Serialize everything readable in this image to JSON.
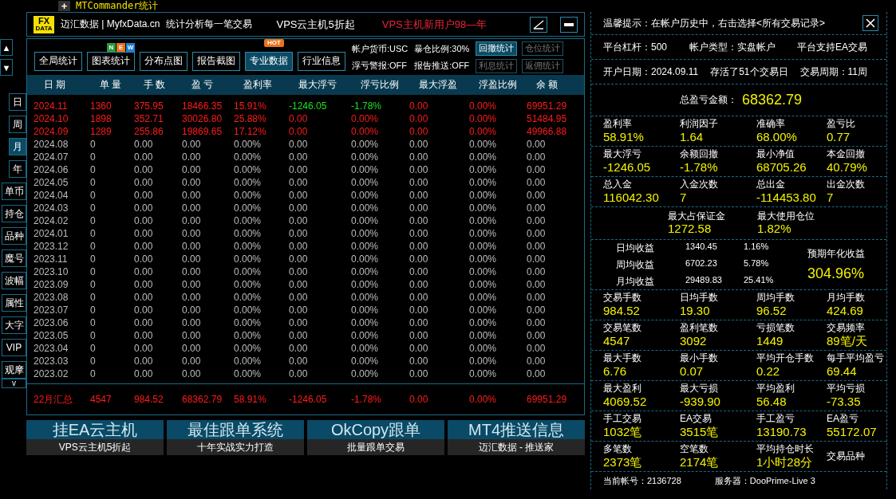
{
  "top_bar": {
    "expand_button": "+",
    "title": "MTCommander统计"
  },
  "header": {
    "logo_top": "FX",
    "logo_bottom": "DATA",
    "brand": "迈汇数据 | MyfxData.cn",
    "slogan": "统计分析每一笔交易",
    "promo": "VPS云主机5折起",
    "promo_highlight": "VPS主机新用户98—年"
  },
  "side_nav": {
    "up": "▲",
    "down": "▼",
    "items": [
      {
        "label": "日",
        "selected": false,
        "kind": "period"
      },
      {
        "label": "周",
        "selected": false,
        "kind": "period"
      },
      {
        "label": "月",
        "selected": true,
        "kind": "period"
      },
      {
        "label": "年",
        "selected": false,
        "kind": "period"
      },
      {
        "label": "单币",
        "selected": false,
        "kind": "view"
      },
      {
        "label": "持仓",
        "selected": false,
        "kind": "view"
      },
      {
        "label": "品种",
        "selected": false,
        "kind": "view"
      },
      {
        "label": "魔号",
        "selected": false,
        "kind": "view"
      },
      {
        "label": "波幅",
        "selected": false,
        "kind": "view"
      },
      {
        "label": "属性",
        "selected": false,
        "kind": "view"
      },
      {
        "label": "大字",
        "selected": false,
        "kind": "view"
      },
      {
        "label": "VIP",
        "selected": false,
        "kind": "view"
      },
      {
        "label": "观摩",
        "selected": false,
        "kind": "view"
      }
    ],
    "more": "v"
  },
  "tabs": [
    {
      "label": "全局统计",
      "selected": false
    },
    {
      "label": "图表统计",
      "selected": false,
      "badge_letters": [
        {
          "text": "N",
          "color": "#2a9a3a"
        },
        {
          "text": "E",
          "color": "#e8731a"
        },
        {
          "text": "W",
          "color": "#1f7fd6"
        }
      ]
    },
    {
      "label": "分布点图",
      "selected": false
    },
    {
      "label": "报告截图",
      "selected": false
    },
    {
      "label": "专业数据",
      "selected": true,
      "badge": "HOT"
    },
    {
      "label": "行业信息",
      "selected": false
    }
  ],
  "account_info": [
    "帐户货币:USC",
    "暴仓比例:30%",
    "浮亏警报:OFF",
    "报告推送:OFF"
  ],
  "tool_buttons": [
    {
      "label": "回撤统计",
      "disabled": false
    },
    {
      "label": "仓位统计",
      "disabled": true
    },
    {
      "label": "利息统计",
      "disabled": true
    },
    {
      "label": "返佣统计",
      "disabled": true
    }
  ],
  "table": {
    "columns": [
      "日 期",
      "单 量",
      "手 数",
      "盈 亏",
      "盈利率",
      "最大浮亏",
      "浮亏比例",
      "最大浮盈",
      "浮盈比例",
      "余 额"
    ],
    "rows": [
      {
        "active": true,
        "floating_loss": true,
        "cells": [
          "2024.11",
          "1360",
          "375.95",
          "18466.35",
          "15.91%",
          "-1246.05",
          "-1.78%",
          "0.00",
          "0.00%",
          "69951.29"
        ]
      },
      {
        "active": true,
        "floating_loss": false,
        "cells": [
          "2024.10",
          "1898",
          "352.71",
          "30026.80",
          "25.88%",
          "0.00",
          "0.00%",
          "0.00",
          "0.00%",
          "51484.95"
        ]
      },
      {
        "active": true,
        "floating_loss": false,
        "cells": [
          "2024.09",
          "1289",
          "255.86",
          "19869.65",
          "17.12%",
          "0.00",
          "0.00%",
          "0.00",
          "0.00%",
          "49966.88"
        ]
      },
      {
        "active": false,
        "cells": [
          "2024.08",
          "0",
          "0.00",
          "0.00",
          "0.00%",
          "0.00",
          "0.00%",
          "0.00",
          "0.00%",
          "0.00"
        ]
      },
      {
        "active": false,
        "cells": [
          "2024.07",
          "0",
          "0.00",
          "0.00",
          "0.00%",
          "0.00",
          "0.00%",
          "0.00",
          "0.00%",
          "0.00"
        ]
      },
      {
        "active": false,
        "cells": [
          "2024.06",
          "0",
          "0.00",
          "0.00",
          "0.00%",
          "0.00",
          "0.00%",
          "0.00",
          "0.00%",
          "0.00"
        ]
      },
      {
        "active": false,
        "cells": [
          "2024.05",
          "0",
          "0.00",
          "0.00",
          "0.00%",
          "0.00",
          "0.00%",
          "0.00",
          "0.00%",
          "0.00"
        ]
      },
      {
        "active": false,
        "cells": [
          "2024.04",
          "0",
          "0.00",
          "0.00",
          "0.00%",
          "0.00",
          "0.00%",
          "0.00",
          "0.00%",
          "0.00"
        ]
      },
      {
        "active": false,
        "cells": [
          "2024.03",
          "0",
          "0.00",
          "0.00",
          "0.00%",
          "0.00",
          "0.00%",
          "0.00",
          "0.00%",
          "0.00"
        ]
      },
      {
        "active": false,
        "cells": [
          "2024.02",
          "0",
          "0.00",
          "0.00",
          "0.00%",
          "0.00",
          "0.00%",
          "0.00",
          "0.00%",
          "0.00"
        ]
      },
      {
        "active": false,
        "cells": [
          "2024.01",
          "0",
          "0.00",
          "0.00",
          "0.00%",
          "0.00",
          "0.00%",
          "0.00",
          "0.00%",
          "0.00"
        ]
      },
      {
        "active": false,
        "cells": [
          "2023.12",
          "0",
          "0.00",
          "0.00",
          "0.00%",
          "0.00",
          "0.00%",
          "0.00",
          "0.00%",
          "0.00"
        ]
      },
      {
        "active": false,
        "cells": [
          "2023.11",
          "0",
          "0.00",
          "0.00",
          "0.00%",
          "0.00",
          "0.00%",
          "0.00",
          "0.00%",
          "0.00"
        ]
      },
      {
        "active": false,
        "cells": [
          "2023.10",
          "0",
          "0.00",
          "0.00",
          "0.00%",
          "0.00",
          "0.00%",
          "0.00",
          "0.00%",
          "0.00"
        ]
      },
      {
        "active": false,
        "cells": [
          "2023.09",
          "0",
          "0.00",
          "0.00",
          "0.00%",
          "0.00",
          "0.00%",
          "0.00",
          "0.00%",
          "0.00"
        ]
      },
      {
        "active": false,
        "cells": [
          "2023.08",
          "0",
          "0.00",
          "0.00",
          "0.00%",
          "0.00",
          "0.00%",
          "0.00",
          "0.00%",
          "0.00"
        ]
      },
      {
        "active": false,
        "cells": [
          "2023.07",
          "0",
          "0.00",
          "0.00",
          "0.00%",
          "0.00",
          "0.00%",
          "0.00",
          "0.00%",
          "0.00"
        ]
      },
      {
        "active": false,
        "cells": [
          "2023.06",
          "0",
          "0.00",
          "0.00",
          "0.00%",
          "0.00",
          "0.00%",
          "0.00",
          "0.00%",
          "0.00"
        ]
      },
      {
        "active": false,
        "cells": [
          "2023.05",
          "0",
          "0.00",
          "0.00",
          "0.00%",
          "0.00",
          "0.00%",
          "0.00",
          "0.00%",
          "0.00"
        ]
      },
      {
        "active": false,
        "cells": [
          "2023.04",
          "0",
          "0.00",
          "0.00",
          "0.00%",
          "0.00",
          "0.00%",
          "0.00",
          "0.00%",
          "0.00"
        ]
      },
      {
        "active": false,
        "cells": [
          "2023.03",
          "0",
          "0.00",
          "0.00",
          "0.00%",
          "0.00",
          "0.00%",
          "0.00",
          "0.00%",
          "0.00"
        ]
      },
      {
        "active": false,
        "cells": [
          "2023.02",
          "0",
          "0.00",
          "0.00",
          "0.00%",
          "0.00",
          "0.00%",
          "0.00",
          "0.00%",
          "0.00"
        ]
      }
    ],
    "summary": [
      "22月汇总",
      "4547",
      "984.52",
      "68362.79",
      "58.91%",
      "-1246.05",
      "-1.78%",
      "0.00",
      "0.00%",
      "69951.29"
    ]
  },
  "promos": [
    {
      "title": "挂EA云主机",
      "subtitle": "VPS云主机5折起"
    },
    {
      "title": "最佳跟单系统",
      "subtitle": "十年实战实力打造"
    },
    {
      "title": "OkCopy跟单",
      "subtitle": "批量跟单交易"
    },
    {
      "title": "MT4推送信息",
      "subtitle": "迈汇数据 - 推送家"
    }
  ],
  "right_panel": {
    "sections": [
      {
        "kind": "tip",
        "text": "温馨提示：在帐户历史中，右击选择<所有交易记录>"
      },
      {
        "kind": "facts",
        "items": [
          "平台杠杆：500",
          "帐户类型：实盘帐户",
          "平台支持EA交易"
        ]
      },
      {
        "kind": "facts",
        "items": [
          "开户日期：2024.09.11",
          "存活了51个交易日",
          "交易周期：11周"
        ]
      },
      {
        "kind": "total",
        "label": "总盈亏金额：",
        "value": "68362.79"
      },
      {
        "kind": "stats",
        "items": [
          {
            "label": "盈利率",
            "value": "58.91%"
          },
          {
            "label": "利润因子",
            "value": "1.64"
          },
          {
            "label": "准确率",
            "value": "68.00%"
          },
          {
            "label": "盈亏比",
            "value": "0.77"
          }
        ]
      },
      {
        "kind": "stats",
        "items": [
          {
            "label": "最大浮亏",
            "value": "-1246.05"
          },
          {
            "label": "余额回撤",
            "value": "-1.78%"
          },
          {
            "label": "最小净值",
            "value": "68705.26"
          },
          {
            "label": "本金回撤",
            "value": "40.79%"
          }
        ]
      },
      {
        "kind": "stats",
        "items": [
          {
            "label": "总入金",
            "value": "116042.30"
          },
          {
            "label": "入金次数",
            "value": "7"
          },
          {
            "label": "总出金",
            "value": "-114453.80"
          },
          {
            "label": "出金次数",
            "value": "7"
          }
        ]
      },
      {
        "kind": "centered",
        "items": [
          {
            "label": "最大占保证金",
            "value": "1272.58"
          },
          {
            "label": "最大使用仓位",
            "value": "1.82%"
          }
        ]
      },
      {
        "kind": "averages",
        "rows": [
          [
            "日均收益",
            "1340.45",
            "1.16%"
          ],
          [
            "周均收益",
            "6702.23",
            "5.78%"
          ],
          [
            "月均收益",
            "29489.83",
            "25.41%"
          ]
        ],
        "label": "预期年化收益",
        "value": "304.96%"
      },
      {
        "kind": "stats",
        "items": [
          {
            "label": "交易手数",
            "value": "984.52"
          },
          {
            "label": "日均手数",
            "value": "19.30"
          },
          {
            "label": "周均手数",
            "value": "96.52"
          },
          {
            "label": "月均手数",
            "value": "424.69"
          }
        ]
      },
      {
        "kind": "stats",
        "items": [
          {
            "label": "交易笔数",
            "value": "4547"
          },
          {
            "label": "盈利笔数",
            "value": "3092"
          },
          {
            "label": "亏损笔数",
            "value": "1449"
          },
          {
            "label": "交易频率",
            "value": "89笔/天"
          }
        ]
      },
      {
        "kind": "stats",
        "items": [
          {
            "label": "最大手数",
            "value": "6.76"
          },
          {
            "label": "最小手数",
            "value": "0.07"
          },
          {
            "label": "平均开仓手数",
            "value": "0.22"
          },
          {
            "label": "每手平均盈亏",
            "value": "69.44"
          }
        ]
      },
      {
        "kind": "stats",
        "items": [
          {
            "label": "最大盈利",
            "value": "4069.52"
          },
          {
            "label": "最大亏损",
            "value": "-939.90"
          },
          {
            "label": "平均盈利",
            "value": "56.48"
          },
          {
            "label": "平均亏损",
            "value": "-73.35"
          }
        ]
      },
      {
        "kind": "stats",
        "items": [
          {
            "label": "手工交易",
            "value": "1032笔"
          },
          {
            "label": "EA交易",
            "value": "3515笔"
          },
          {
            "label": "手工盈亏",
            "value": "13190.73"
          },
          {
            "label": "EA盈亏",
            "value": "55172.07"
          }
        ]
      },
      {
        "kind": "stats",
        "items": [
          {
            "label": "多笔数",
            "value": "2373笔"
          },
          {
            "label": "空笔数",
            "value": "2174笔"
          },
          {
            "label": "平均持仓时长",
            "value": "1小时28分"
          },
          {
            "label": "交易品种"
          }
        ]
      },
      {
        "kind": "footer",
        "items": [
          "当前帐号：2136728",
          "服务器：DooPrime-Live 3"
        ]
      }
    ]
  }
}
